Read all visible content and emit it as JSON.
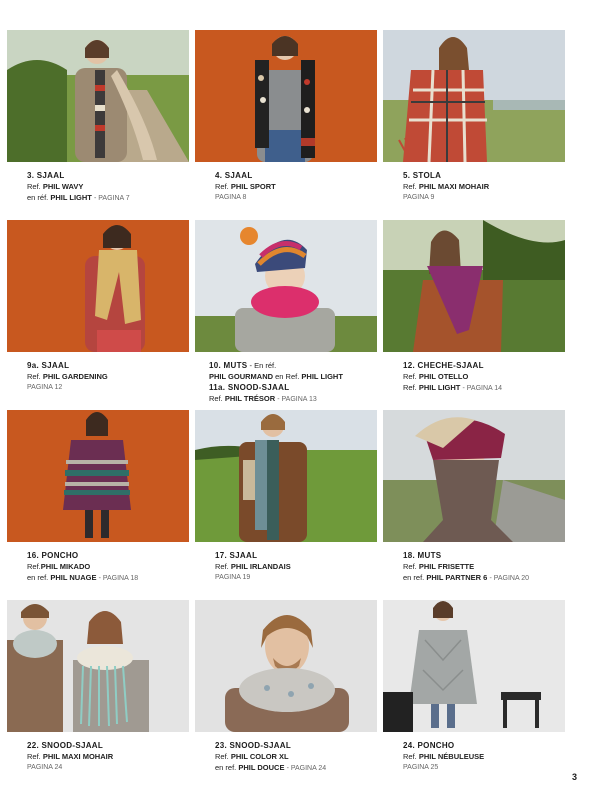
{
  "items": [
    {
      "title": "3. SJAAL",
      "l1_pre": "Ref.",
      "l1_ref": "PHIL WAVY",
      "l1_post": "",
      "l2_pre": "en réf.",
      "l2_ref": "PHIL LIGHT",
      "l2_post": "- PAGINA 7",
      "l3_pre": "",
      "l3_ref": "",
      "l3_post": ""
    },
    {
      "title": "4. SJAAL",
      "l1_pre": "Ref.",
      "l1_ref": "PHIL SPORT",
      "l1_post": "",
      "l2_pre": "PAGINA 8",
      "l2_ref": "",
      "l2_post": "",
      "l3_pre": "",
      "l3_ref": "",
      "l3_post": ""
    },
    {
      "title": "5. STOLA",
      "l1_pre": "Ref.",
      "l1_ref": "PHIL MAXI MOHAIR",
      "l1_post": "",
      "l2_pre": "PAGINA 9",
      "l2_ref": "",
      "l2_post": "",
      "l3_pre": "",
      "l3_ref": "",
      "l3_post": ""
    },
    {
      "title": "9a. SJAAL",
      "l1_pre": "Ref.",
      "l1_ref": "PHIL GARDENING",
      "l1_post": "",
      "l2_pre": "PAGINA 12",
      "l2_ref": "",
      "l2_post": "",
      "l3_pre": "",
      "l3_ref": "",
      "l3_post": ""
    },
    {
      "title": "10. MUTS",
      "l1_pre": "",
      "l1_ref": "PHIL GOURMAND",
      "l1_post": "en Ref.",
      "l1_ref2": "PHIL LIGHT",
      "title_suffix": " -  En réf.",
      "title2": "11a. SNOOD-SJAAL",
      "l2_pre": "Ref.",
      "l2_ref": "PHIL TRÉSOR",
      "l2_post": "- PAGINA 13"
    },
    {
      "title": "12. CHECHE-SJAAL",
      "l1_pre": "Ref.",
      "l1_ref": "PHIL OTELLO",
      "l1_post": "",
      "l2_pre": "Ref.",
      "l2_ref": "PHIL LIGHT",
      "l2_post": "- PAGINA 14",
      "l3_pre": "",
      "l3_ref": "",
      "l3_post": ""
    },
    {
      "title": "16. PONCHO",
      "l1_pre": "Ref.",
      "l1_ref": "PHIL MIKADO",
      "l1_post": "",
      "l2_pre": "en ref.",
      "l2_ref": "PHIL NUAGE",
      "l2_post": "- PAGINA 18",
      "l3_pre": "",
      "l3_ref": "",
      "l3_post": ""
    },
    {
      "title": "17. SJAAL",
      "l1_pre": "Ref.",
      "l1_ref": "PHIL IRLANDAIS",
      "l1_post": "",
      "l2_pre": "PAGINA 19",
      "l2_ref": "",
      "l2_post": "",
      "l3_pre": "",
      "l3_ref": "",
      "l3_post": ""
    },
    {
      "title": "18. MUTS",
      "l1_pre": "Ref.",
      "l1_ref": "PHIL FRISETTE",
      "l1_post": "",
      "l2_pre": "en ref.",
      "l2_ref": "PHIL PARTNER 6",
      "l2_post": "- PAGINA 20",
      "l3_pre": "",
      "l3_ref": "",
      "l3_post": ""
    },
    {
      "title": "22. SNOOD-SJAAL",
      "l1_pre": "Ref.",
      "l1_ref": "PHIL MAXI MOHAIR",
      "l1_post": "",
      "l2_pre": "PAGINA 24",
      "l2_ref": "",
      "l2_post": "",
      "l3_pre": "",
      "l3_ref": "",
      "l3_post": ""
    },
    {
      "title": "23. SNOOD-SJAAL",
      "l1_pre": "Ref.",
      "l1_ref": "PHIL COLOR XL",
      "l1_post": "",
      "l2_pre": "en ref.",
      "l2_ref": "PHIL DOUCE",
      "l2_post": "- PAGINA 24",
      "l3_pre": "",
      "l3_ref": "",
      "l3_post": ""
    },
    {
      "title": "24. PONCHO",
      "l1_pre": "Ref.",
      "l1_ref": "PHIL NÉBULEUSE",
      "l1_post": "",
      "l2_pre": "PAGINA 25",
      "l2_ref": "",
      "l2_post": "",
      "l3_pre": "",
      "l3_ref": "",
      "l3_post": ""
    }
  ],
  "page_number": "3",
  "colors": {
    "orange": "#c8581f",
    "grass": "#6f8f3c",
    "sky": "#cfd7de",
    "grey_bg": "#e4e4e4"
  }
}
